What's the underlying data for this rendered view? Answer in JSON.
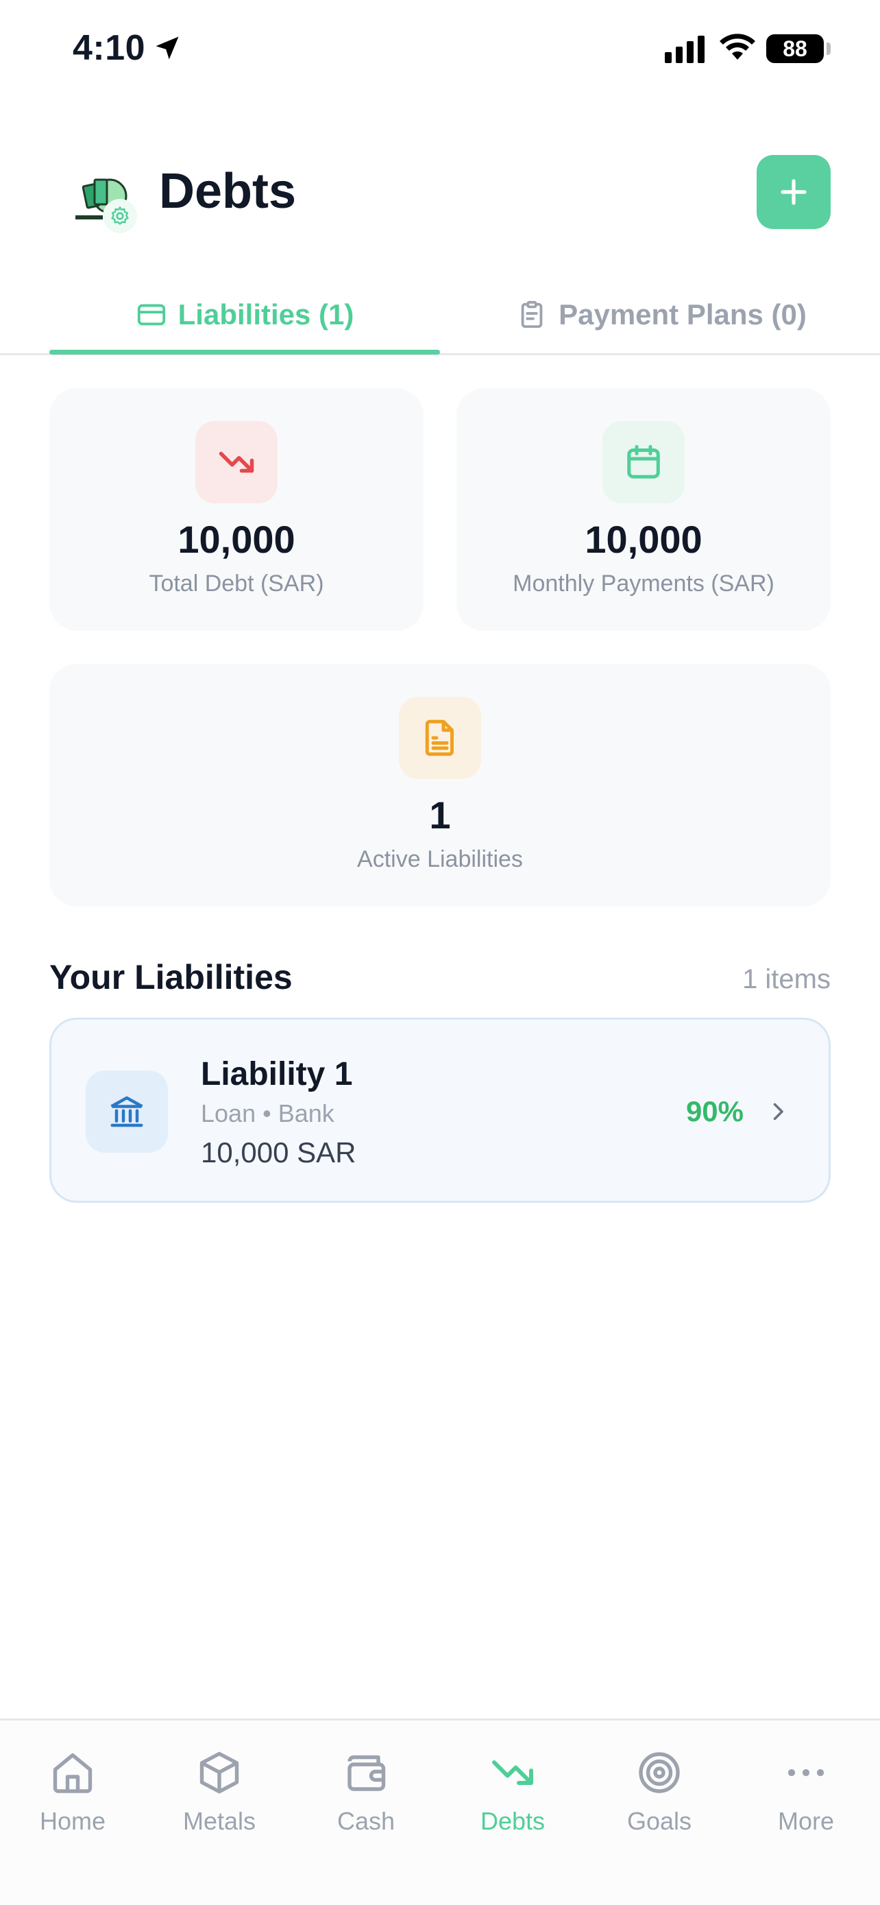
{
  "status_bar": {
    "time": "4:10",
    "battery": "88"
  },
  "header": {
    "title": "Debts"
  },
  "tabs": [
    {
      "label": "Liabilities (1)",
      "active": true
    },
    {
      "label": "Payment Plans (0)",
      "active": false
    }
  ],
  "stats": {
    "total_debt": {
      "value": "10,000",
      "label": "Total Debt (SAR)"
    },
    "monthly_payments": {
      "value": "10,000",
      "label": "Monthly Payments (SAR)"
    },
    "active_liabilities": {
      "value": "1",
      "label": "Active Liabilities"
    }
  },
  "section": {
    "title": "Your Liabilities",
    "count": "1 items"
  },
  "liabilities": [
    {
      "name": "Liability 1",
      "meta": "Loan • Bank",
      "amount": "10,000 SAR",
      "percent": "90%"
    }
  ],
  "nav": [
    {
      "label": "Home"
    },
    {
      "label": "Metals"
    },
    {
      "label": "Cash"
    },
    {
      "label": "Debts",
      "active": true
    },
    {
      "label": "Goals"
    },
    {
      "label": "More"
    }
  ],
  "colors": {
    "accent": "#5ad0a0",
    "debt_red": "#e5484d",
    "calendar_green": "#4fcf98",
    "doc_orange": "#f0a020",
    "bank_blue": "#2b78c5",
    "percent_green": "#35b96a"
  }
}
